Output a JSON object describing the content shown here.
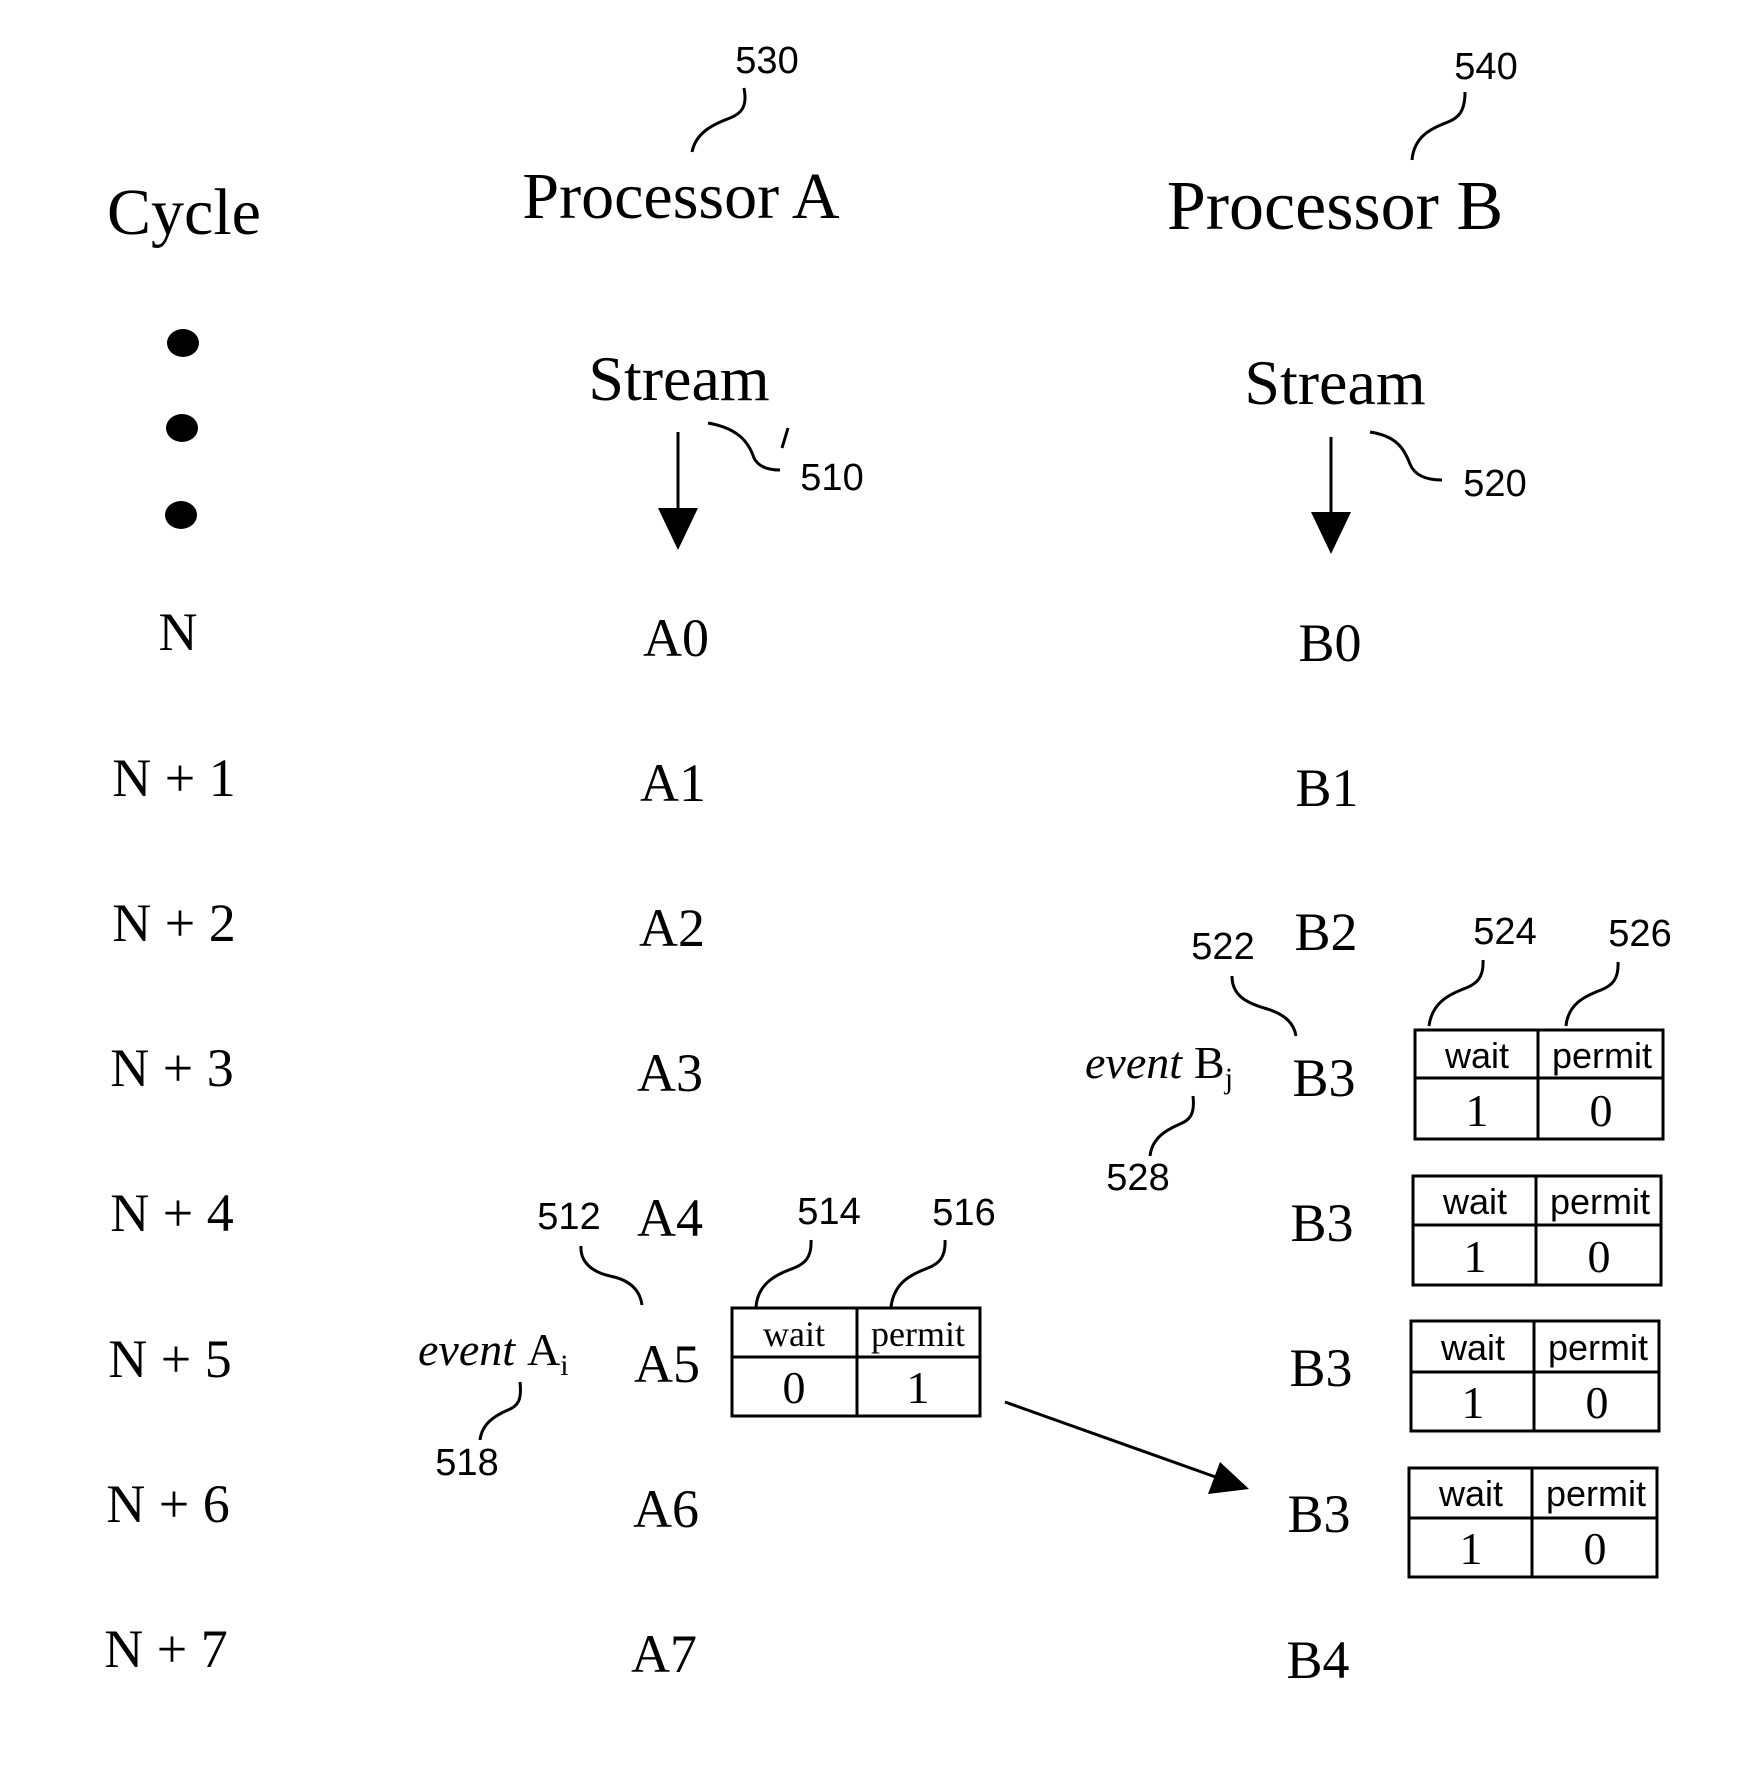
{
  "headers": {
    "cycle": "Cycle",
    "processor_a": "Processor A",
    "processor_b": "Processor B",
    "ref_processor_a": "530",
    "ref_processor_b": "540"
  },
  "streams": {
    "a_label": "Stream",
    "b_label": "Stream",
    "a_ref": "510",
    "b_ref": "520"
  },
  "rows": [
    {
      "cycle": "N",
      "a": "A0",
      "b": "B0"
    },
    {
      "cycle": "N + 1",
      "a": "A1",
      "b": "B1"
    },
    {
      "cycle": "N + 2",
      "a": "A2",
      "b": "B2"
    },
    {
      "cycle": "N + 3",
      "a": "A3",
      "b": "B3"
    },
    {
      "cycle": "N + 4",
      "a": "A4",
      "b": "B3"
    },
    {
      "cycle": "N + 5",
      "a": "A5",
      "b": "B3"
    },
    {
      "cycle": "N + 6",
      "a": "A6",
      "b": "B3"
    },
    {
      "cycle": "N + 7",
      "a": "A7",
      "b": "B4"
    }
  ],
  "event_a": {
    "word": "event",
    "name": "A",
    "subscript": "i",
    "ref": "518",
    "instr_ref": "512",
    "wait_ref": "514",
    "permit_ref": "516"
  },
  "event_b": {
    "word": "event",
    "name": "B",
    "subscript": "j",
    "ref": "528",
    "instr_ref": "522",
    "wait_ref": "524",
    "permit_ref": "526"
  },
  "table_a": {
    "wait_label": "wait",
    "permit_label": "permit",
    "wait": "0",
    "permit": "1"
  },
  "tables_b": [
    {
      "wait_label": "wait",
      "permit_label": "permit",
      "wait": "1",
      "permit": "0"
    },
    {
      "wait_label": "wait",
      "permit_label": "permit",
      "wait": "1",
      "permit": "0"
    },
    {
      "wait_label": "wait",
      "permit_label": "permit",
      "wait": "1",
      "permit": "0"
    },
    {
      "wait_label": "wait",
      "permit_label": "permit",
      "wait": "1",
      "permit": "0"
    }
  ]
}
